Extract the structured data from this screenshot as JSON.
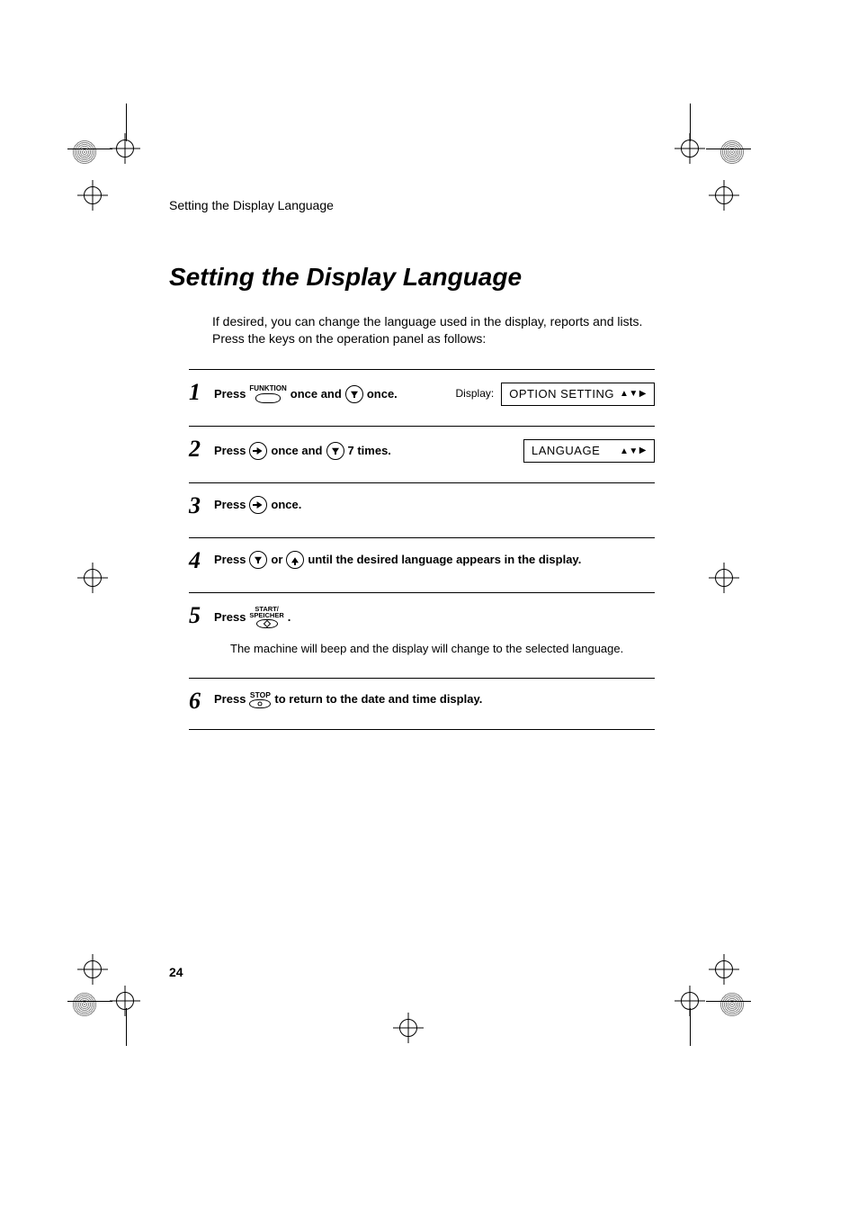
{
  "running_header": "Setting the Display Language",
  "heading": "Setting the Display Language",
  "intro": "If desired, you can change the language used in the display, reports and lists. Press the keys on the operation panel as follows:",
  "display_label": "Display:",
  "keys": {
    "funktion": "FUNKTION",
    "start_line1": "START/",
    "start_line2": "SPEICHER",
    "stop": "STOP"
  },
  "steps": [
    {
      "num": "1",
      "parts": {
        "a": "Press",
        "b": "once and",
        "c": "once."
      },
      "lcd": "OPTION SETTING"
    },
    {
      "num": "2",
      "parts": {
        "a": "Press",
        "b": "once and",
        "c": "7 times."
      },
      "lcd": "LANGUAGE"
    },
    {
      "num": "3",
      "parts": {
        "a": "Press",
        "b": "once."
      }
    },
    {
      "num": "4",
      "parts": {
        "a": "Press",
        "b": "or",
        "c": "until the desired language appears in the display."
      }
    },
    {
      "num": "5",
      "parts": {
        "a": "Press",
        "b": "."
      },
      "note": "The machine will beep and the display will change to the selected language."
    },
    {
      "num": "6",
      "parts": {
        "a": "Press",
        "b": "to return to the date and time display."
      }
    }
  ],
  "page_number": "24"
}
